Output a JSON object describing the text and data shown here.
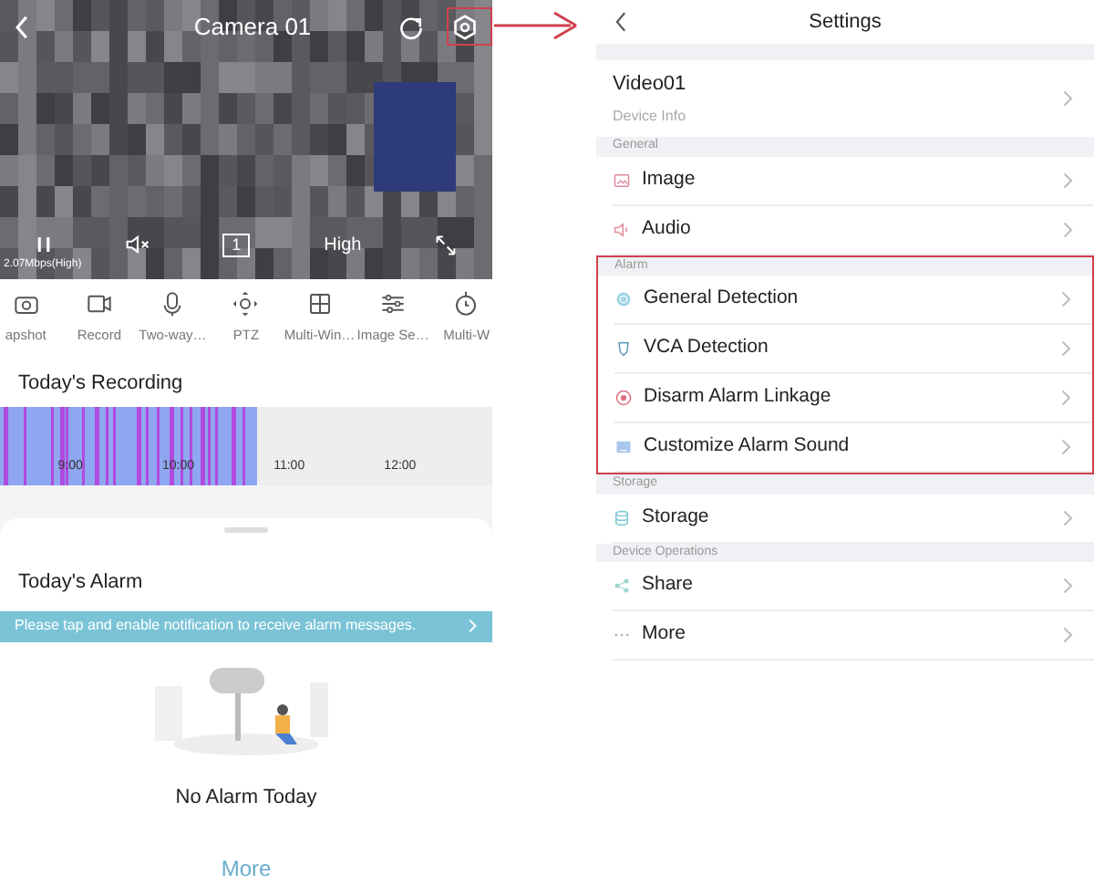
{
  "camera": {
    "title": "Camera 01",
    "bitrate": "2.07Mbps(High)",
    "quality": "High",
    "channel": "1"
  },
  "tools": [
    {
      "label": "apshot"
    },
    {
      "label": "Record"
    },
    {
      "label": "Two-way…"
    },
    {
      "label": "PTZ"
    },
    {
      "label": "Multi-Win…"
    },
    {
      "label": "Image Se…"
    },
    {
      "label": "Multi-W"
    }
  ],
  "recording": {
    "title": "Today's Recording",
    "times": [
      "9:00",
      "10:00",
      "11:00",
      "12:00"
    ]
  },
  "alarm": {
    "title": "Today's Alarm",
    "banner": "Please tap and enable notification to receive alarm messages.",
    "empty": "No Alarm Today",
    "more": "More"
  },
  "settings": {
    "title": "Settings",
    "device": {
      "name": "Video01",
      "subtitle": "Device Info"
    },
    "items": [
      {
        "kind": "section",
        "label": "General"
      },
      {
        "kind": "item",
        "label": "Image"
      },
      {
        "kind": "item",
        "label": "Audio"
      },
      {
        "kind": "section",
        "label": "Alarm",
        "highlighted": true
      },
      {
        "kind": "item",
        "label": "General Detection",
        "highlighted": true
      },
      {
        "kind": "item",
        "label": "VCA Detection",
        "highlighted": true
      },
      {
        "kind": "item",
        "label": "Disarm Alarm Linkage",
        "highlighted": true
      },
      {
        "kind": "item",
        "label": "Customize Alarm Sound",
        "highlighted": true
      },
      {
        "kind": "section",
        "label": "Storage"
      },
      {
        "kind": "item",
        "label": "Storage"
      },
      {
        "kind": "section",
        "label": "Device Operations"
      },
      {
        "kind": "item",
        "label": "Share"
      },
      {
        "kind": "item",
        "label": "More"
      }
    ]
  }
}
